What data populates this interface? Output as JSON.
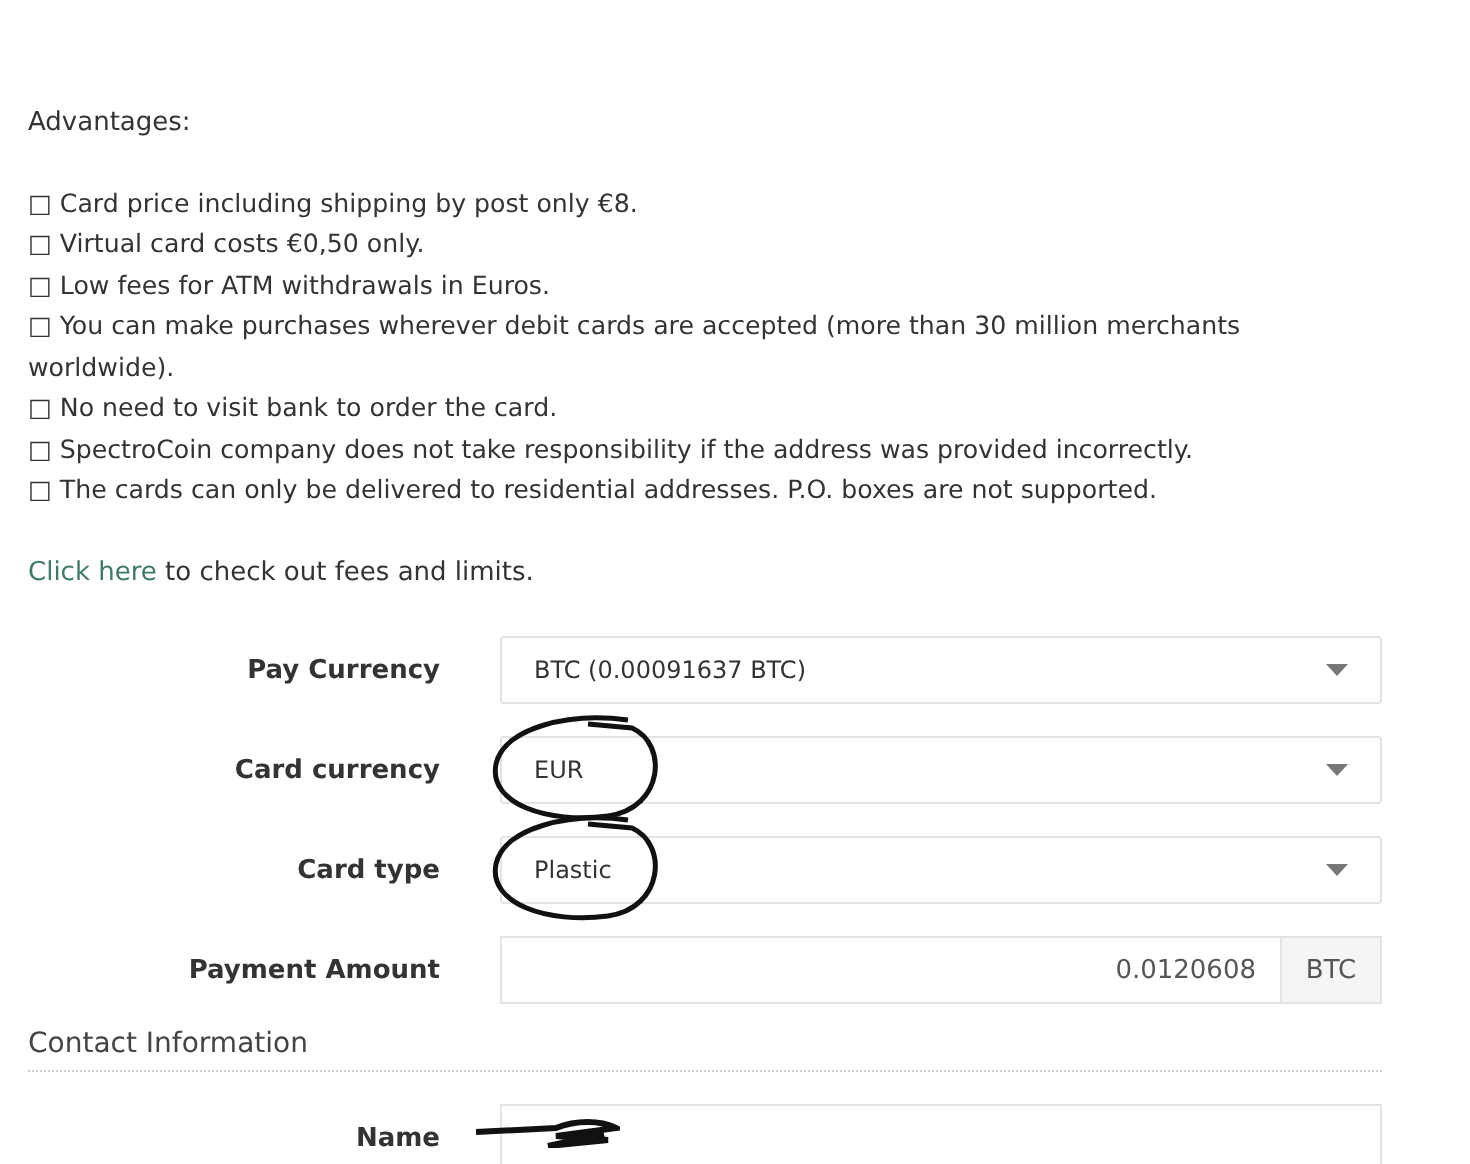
{
  "intro": {
    "heading": "Advantages:",
    "items": [
      "□ Card price including shipping by post only €8.",
      "□ Virtual card costs €0,50 only.",
      "□ Low fees for ATM withdrawals in Euros.",
      "□ You can make purchases wherever debit cards are accepted (more than 30 million merchants worldwide).",
      "□ No need to visit bank to order the card.",
      "□ SpectroCoin company does not take responsibility if the address was provided incorrectly.",
      "□ The cards can only be delivered to residential addresses. P.O. boxes are not supported."
    ],
    "link": {
      "label": "Click here",
      "rest": " to check out fees and limits."
    }
  },
  "fields": [
    {
      "kind": "select",
      "label": "Pay Currency",
      "value": "BTC (0.00091637 BTC)",
      "circled": false
    },
    {
      "kind": "select",
      "label": "Card currency",
      "value": "EUR",
      "circled": true
    },
    {
      "kind": "select",
      "label": "Card type",
      "value": "Plastic",
      "circled": true
    },
    {
      "kind": "amount",
      "label": "Payment Amount",
      "value": "0.0120608",
      "unit": "BTC",
      "circled": false
    }
  ],
  "contact": {
    "heading": "Contact Information",
    "fields": [
      {
        "label": "Name",
        "redacted": true
      }
    ]
  }
}
